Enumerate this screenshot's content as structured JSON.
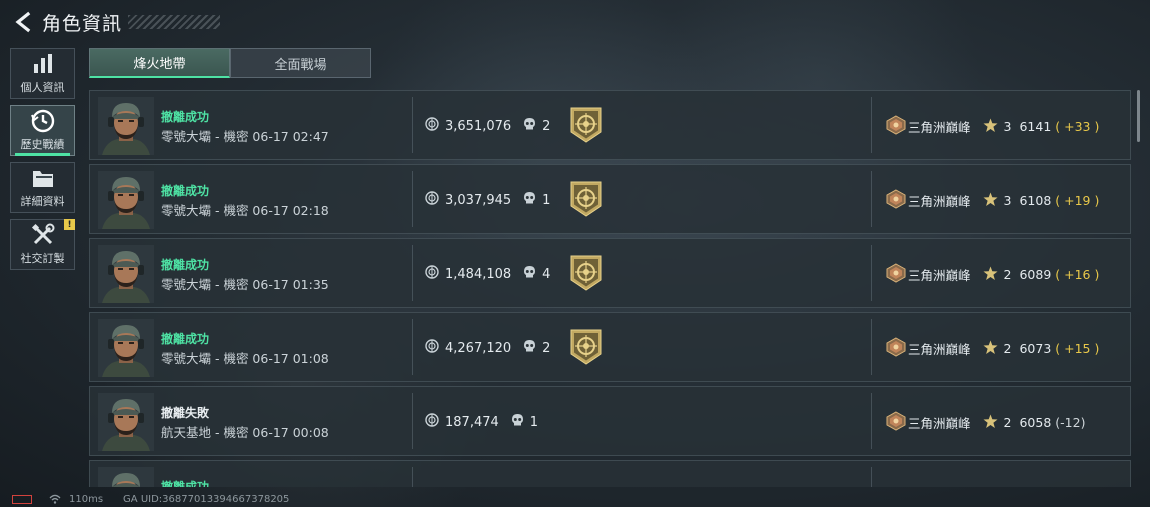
{
  "header": {
    "title": "角色資訊"
  },
  "sidebar": {
    "items": [
      {
        "label": "個人資訊",
        "icon": "bar-chart-icon"
      },
      {
        "label": "歷史戰績",
        "icon": "history-clock-icon",
        "active": true
      },
      {
        "label": "詳細資料",
        "icon": "folder-icon"
      },
      {
        "label": "社交訂製",
        "icon": "tools-icon",
        "badge": "!"
      }
    ]
  },
  "tabs": [
    {
      "label": "烽火地帶",
      "active": true
    },
    {
      "label": "全面戰場",
      "active": false
    }
  ],
  "colors": {
    "accent": "#4ee2a4",
    "gold": "#e8c84a",
    "alert": "#d2423d"
  },
  "matches": [
    {
      "status": "撤離成功",
      "detail": "零號大壩 - 機密 06-17 02:47",
      "value": "3,651,076",
      "kills": "2",
      "medal": true,
      "rank_name": "三角洲巔峰",
      "stars": "3",
      "score": "6141",
      "delta": "( +33 )"
    },
    {
      "status": "撤離成功",
      "detail": "零號大壩 - 機密 06-17 02:18",
      "value": "3,037,945",
      "kills": "1",
      "medal": true,
      "rank_name": "三角洲巔峰",
      "stars": "3",
      "score": "6108",
      "delta": "( +19 )"
    },
    {
      "status": "撤離成功",
      "detail": "零號大壩 - 機密 06-17 01:35",
      "value": "1,484,108",
      "kills": "4",
      "medal": true,
      "rank_name": "三角洲巔峰",
      "stars": "2",
      "score": "6089",
      "delta": "( +16 )"
    },
    {
      "status": "撤離成功",
      "detail": "零號大壩 - 機密 06-17 01:08",
      "value": "4,267,120",
      "kills": "2",
      "medal": true,
      "rank_name": "三角洲巔峰",
      "stars": "2",
      "score": "6073",
      "delta": "( +15 )"
    },
    {
      "status": "撤離失敗",
      "detail": "航天基地 - 機密 06-17 00:08",
      "value": "187,474",
      "kills": "1",
      "medal": false,
      "rank_name": "三角洲巔峰",
      "stars": "2",
      "score": "6058",
      "delta": "(-12)"
    },
    {
      "status": "撤離成功",
      "detail": "",
      "value": "",
      "kills": "",
      "medal": false,
      "rank_name": "",
      "stars": "",
      "score": "",
      "delta": ""
    }
  ],
  "footer": {
    "ping": "110ms",
    "uid": "GA UID:3687701339466737820​5"
  }
}
